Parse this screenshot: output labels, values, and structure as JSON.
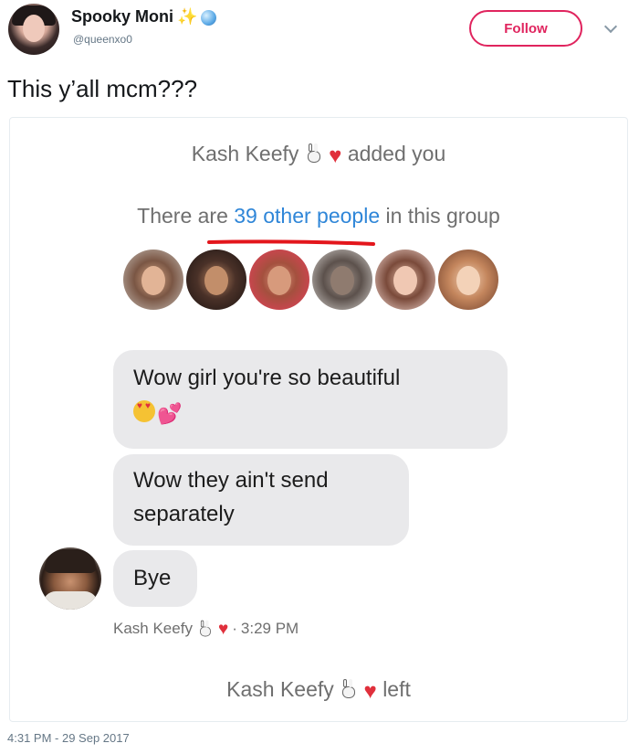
{
  "header": {
    "display_name": "Spooky Moni",
    "sparkle_glyph": "✨",
    "handle": "@queenxo0",
    "follow_label": "Follow",
    "accent_color": "#e0245e"
  },
  "tweet": {
    "text": "This y’all mcm???",
    "timestamp": "4:31 PM - 29 Sep 2017"
  },
  "screenshot": {
    "added_name": "Kash Keefy",
    "added_suffix": "added you",
    "group_prefix": "There are",
    "group_link": "39 other people",
    "group_suffix": "in this group",
    "participants_count_shown": 6,
    "messages": [
      {
        "text": "Wow girl you're so beautiful",
        "emoji": "heart-eyes, two-hearts"
      },
      {
        "text": "Wow they ain't send separately"
      },
      {
        "text": "Bye"
      }
    ],
    "meta_name": "Kash Keefy",
    "meta_time": "3:29 PM",
    "meta_separator": "·",
    "left_name": "Kash Keefy",
    "left_suffix": "left",
    "emoji_icons": [
      "bunny-icon",
      "broken-heart-icon"
    ]
  }
}
